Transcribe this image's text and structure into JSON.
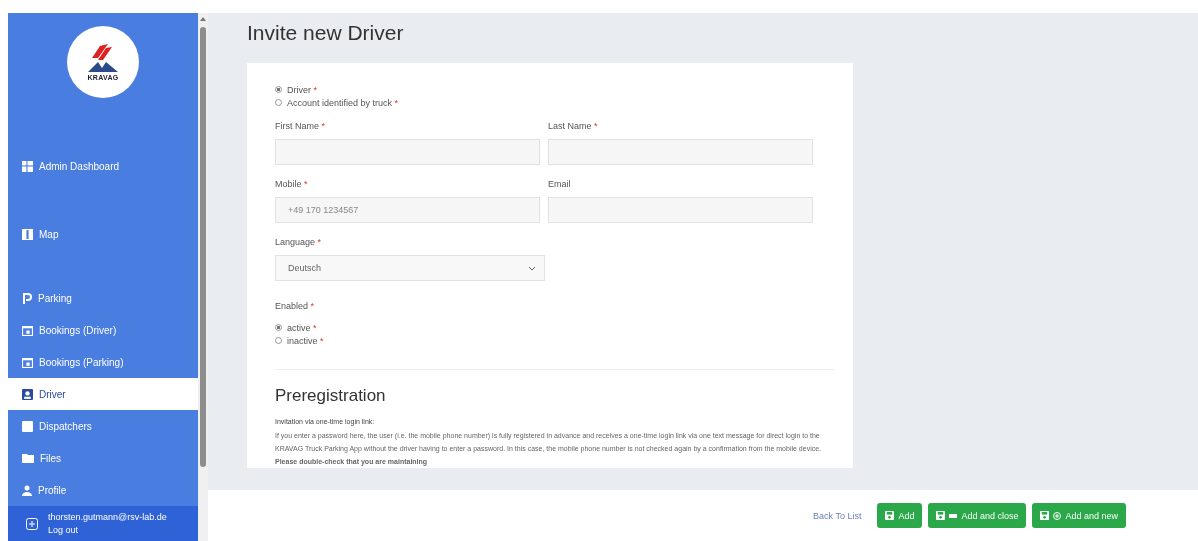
{
  "sidebar": {
    "logo_text": "KRAVAG",
    "items": [
      {
        "label": "Admin Dashboard",
        "selected": false
      },
      {
        "label": "Map",
        "selected": false
      },
      {
        "label": "Parking",
        "selected": false
      },
      {
        "label": "Bookings (Driver)",
        "selected": false
      },
      {
        "label": "Bookings (Parking)",
        "selected": false
      },
      {
        "label": "Driver",
        "selected": true
      },
      {
        "label": "Dispatchers",
        "selected": false
      },
      {
        "label": "Files",
        "selected": false
      },
      {
        "label": "Profile",
        "selected": false
      }
    ],
    "user": {
      "email": "thorsten.gutmann@rsv-lab.de",
      "logout": "Log out"
    }
  },
  "page": {
    "title": "Invite new Driver"
  },
  "form": {
    "account_type": [
      {
        "label": "Driver",
        "marker": "*",
        "selected": true
      },
      {
        "label": "Account identified by truck",
        "marker": "*",
        "selected": false
      }
    ],
    "fields": [
      {
        "label": "First Name",
        "marker": "*"
      },
      {
        "label": "Last Name",
        "marker": "*"
      },
      {
        "label": "Mobile",
        "marker": "*",
        "placeholder": "+49 170 1234567"
      },
      {
        "label": "Email"
      }
    ],
    "language": {
      "label": "Language",
      "marker": "*",
      "value": "Deutsch"
    },
    "enabled": {
      "label": "Enabled",
      "marker": "*",
      "options": [
        {
          "label": "active",
          "marker": "*",
          "selected": true
        },
        {
          "label": "inactive",
          "marker": "*",
          "selected": false
        }
      ]
    },
    "preregistration": {
      "title": "Preregistration",
      "lead": "Invitation via one-time login link:",
      "text": "If you enter a password here, the user (i.e. the mobile phone number) is fully registered in advance and receives a one-time login link via one text message for direct login to the KRAVAG Truck Parking App without the driver having to enter a password. In this case, the mobile phone number is not checked again by a confirmation from the mobile device. **Please double-check that you are maintaining**"
    }
  },
  "footer": {
    "back": "Back To List",
    "buttons": [
      {
        "label": "Add"
      },
      {
        "label": "Add and close"
      },
      {
        "label": "Add and new"
      }
    ]
  }
}
